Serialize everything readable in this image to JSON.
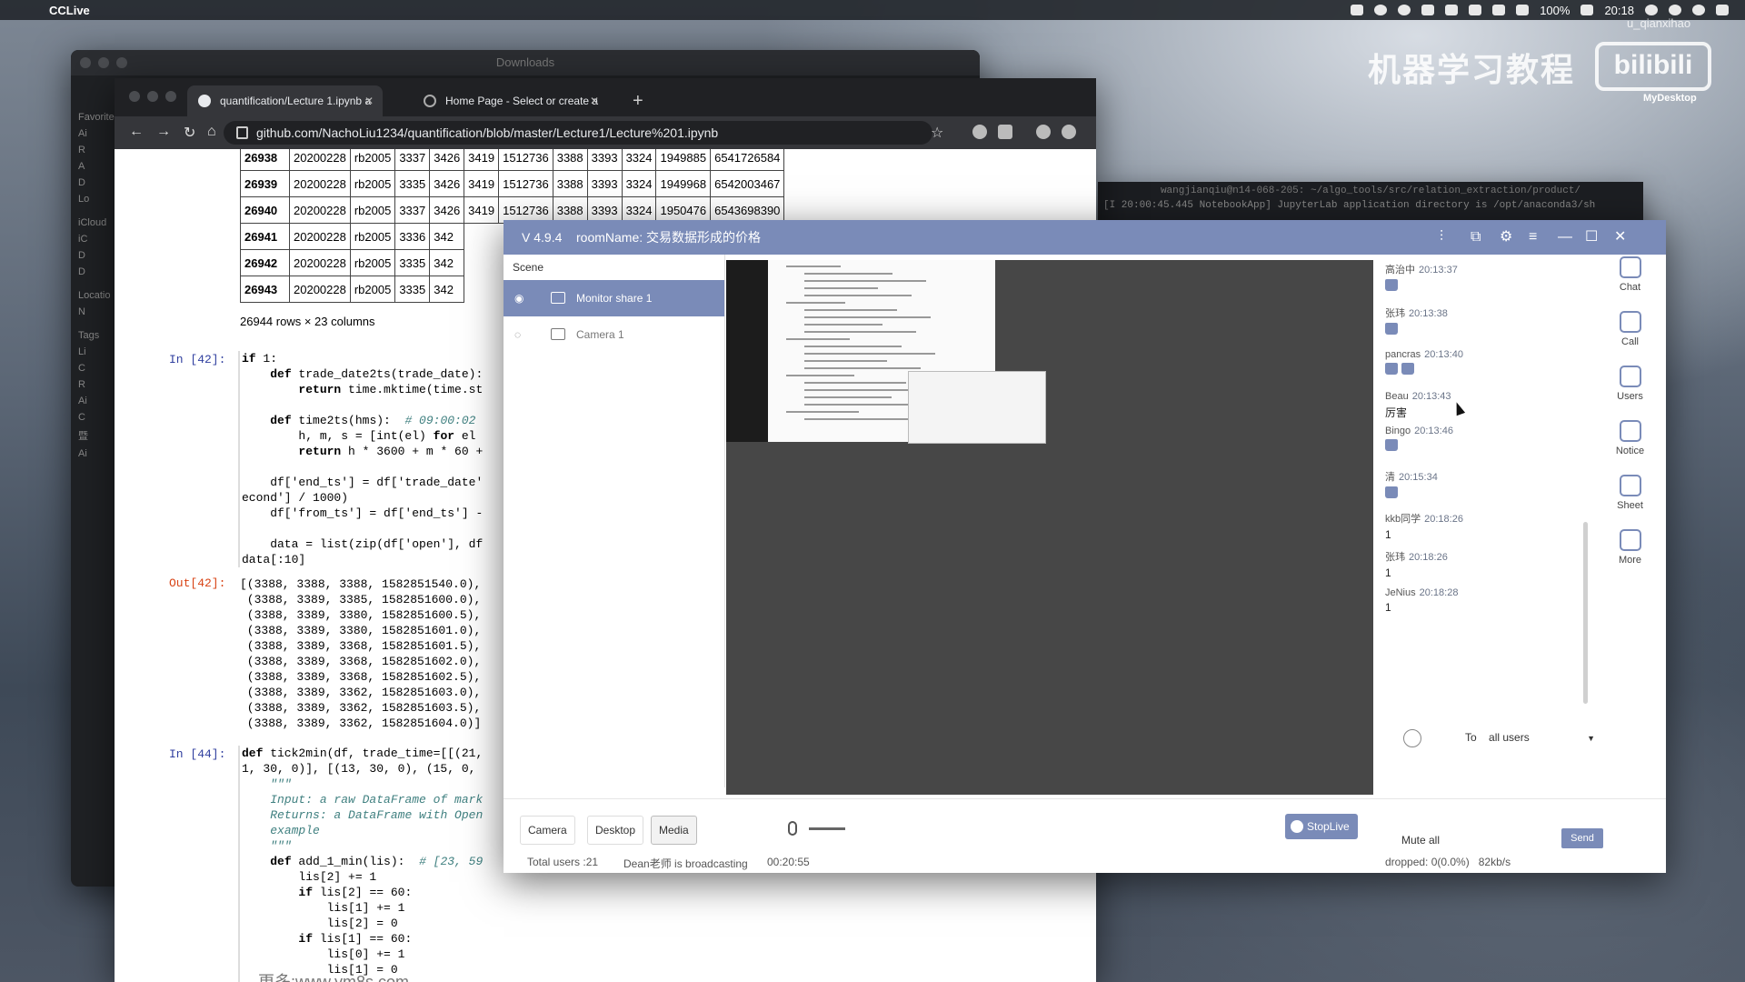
{
  "menubar": {
    "app": "CCLive",
    "battery": "100%",
    "time": "20:18",
    "user": "u_qianxihao"
  },
  "desktop": {
    "watermark": "机器学习教程",
    "bili": "bilibili",
    "mydesktop": "MyDesktop"
  },
  "finder": {
    "title": "Downloads",
    "sidebar": [
      "Favorites",
      "Ai",
      "R",
      "A",
      "D",
      "Lo",
      "iCloud",
      "iC",
      "D",
      "D",
      "Locatio",
      "N",
      "Tags",
      "Li",
      "C",
      "R",
      "Ai",
      "C",
      "暨",
      "Ai"
    ]
  },
  "browser": {
    "tabs": [
      {
        "label": "quantification/Lecture 1.ipynb a"
      },
      {
        "label": "Home Page - Select or create a"
      }
    ],
    "url": "github.com/NachoLiu1234/quantification/blob/master/Lecture1/Lecture%201.ipynb",
    "table_rows": [
      [
        "26938",
        "20200228",
        "rb2005",
        "3337",
        "3426",
        "3419",
        "1512736",
        "3388",
        "3393",
        "3324",
        "1949885",
        "6541726584"
      ],
      [
        "26939",
        "20200228",
        "rb2005",
        "3335",
        "3426",
        "3419",
        "1512736",
        "3388",
        "3393",
        "3324",
        "1949968",
        "6542003467"
      ],
      [
        "26940",
        "20200228",
        "rb2005",
        "3337",
        "3426",
        "3419",
        "1512736",
        "3388",
        "3393",
        "3324",
        "1950476",
        "6543698390"
      ],
      [
        "26941",
        "20200228",
        "rb2005",
        "3336",
        "342"
      ],
      [
        "26942",
        "20200228",
        "rb2005",
        "3335",
        "342"
      ],
      [
        "26943",
        "20200228",
        "rb2005",
        "3335",
        "342"
      ]
    ],
    "rows_cols": "26944 rows × 23 columns",
    "in42": "In [42]:",
    "out42": "Out[42]:",
    "in44": "In [44]:",
    "site_watermark": "更多:www.ym8s.com"
  },
  "terminal": {
    "title": "wangjianqiu@n14-068-205: ~/algo_tools/src/relation_extraction/product/",
    "line": "[I 20:00:45.445 NotebookApp] JupyterLab application directory is /opt/anaconda3/sh"
  },
  "cclive": {
    "version": "V 4.9.4",
    "room": "roomName: 交易数据形成的价格",
    "scene_header": "Scene",
    "scenes": [
      "Monitor share 1",
      "Camera 1"
    ],
    "chat": [
      {
        "name": "高治中",
        "time": "20:13:37",
        "body": ""
      },
      {
        "name": "张玮",
        "time": "20:13:38",
        "body": ""
      },
      {
        "name": "pancras",
        "time": "20:13:40",
        "body": ""
      },
      {
        "name": "Beau",
        "time": "20:13:43",
        "body": "厉害"
      },
      {
        "name": "Bingo",
        "time": "20:13:46",
        "body": ""
      },
      {
        "name": "清",
        "time": "20:15:34",
        "body": ""
      },
      {
        "name": "kkb同学",
        "time": "20:18:26",
        "body": "1"
      },
      {
        "name": "张玮",
        "time": "20:18:26",
        "body": "1"
      },
      {
        "name": "JeNius",
        "time": "20:18:28",
        "body": "1"
      }
    ],
    "sidebar": [
      "Chat",
      "Call",
      "Users",
      "Notice",
      "Sheet",
      "More"
    ],
    "to_label": "To",
    "to_value": "all users",
    "sources": [
      "Camera",
      "Desktop",
      "Media"
    ],
    "stoplive": "StopLive",
    "total_users": "Total users :21",
    "broadcasting": "Dean老师 is broadcasting",
    "elapsed": "00:20:55",
    "mute_all": "Mute all",
    "send": "Send",
    "dropped": "dropped: 0(0.0%)",
    "rate": "82kb/s"
  }
}
